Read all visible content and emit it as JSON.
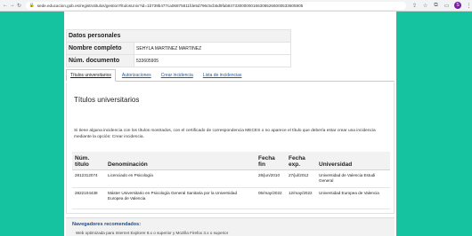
{
  "browser": {
    "url": "sede.educacion.gob.es/registrotitulos/gestionTitulosUniv?id=1b739b477ca06875811fde5d796c5cb5d9fab847330000001663065266000533605905",
    "avatar_letter": "S"
  },
  "personal": {
    "section_title": "Datos personales",
    "name_label": "Nombre completo",
    "name_value": "SEHYLA MARTINEZ MARTINEZ",
    "doc_label": "Núm. documento",
    "doc_value": "533605905"
  },
  "tabs": [
    {
      "label": "Títulos universitarios",
      "active": true
    },
    {
      "label": "Autorizaciones",
      "active": false
    },
    {
      "label": "Crear incidencia",
      "active": false
    },
    {
      "label": "Lista de incidencias",
      "active": false
    }
  ],
  "content": {
    "title": "Títulos universitarios",
    "info": "Si tiene alguna incidencia con los títulos mostrados, con el certificado de correspondencia MECES o no aparece el título que debería estar crear una incidencia mediante la opción: Crear incidencia."
  },
  "table": {
    "headers": {
      "num": "Núm. título",
      "denominacion": "Denominación",
      "fecha_fin": "Fecha fin",
      "fecha_exp": "Fecha exp.",
      "universidad": "Universidad"
    },
    "rows": [
      {
        "num": "2812312074",
        "denominacion": "Licenciado en Psicología",
        "fecha_fin": "28/jun/2010",
        "fecha_exp": "27/jul/2012",
        "universidad": "Universidad de Valencia Estudi General"
      },
      {
        "num": "2822104438",
        "denominacion": "Máster Universitario en Psicología General Sanitaria por la Universidad Europea de Valencia",
        "fecha_fin": "05/may/2022",
        "fecha_exp": "12/may/2022",
        "universidad": "Universidad Europea de Valencia"
      }
    ]
  },
  "footer": {
    "title": "Navegadores recomendados:",
    "text": "Web optimizada para Internet Explorer 8.x o superior y Mozilla Firefox 3.x o superior"
  }
}
